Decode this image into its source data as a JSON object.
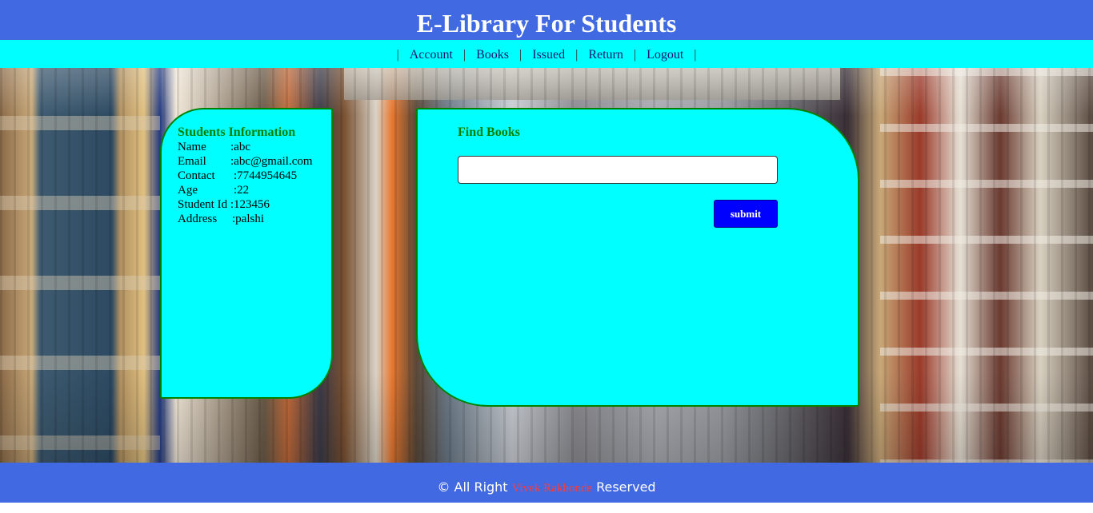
{
  "header": {
    "title": "E-Library For Students"
  },
  "nav": {
    "separator": "|",
    "items": [
      "Account",
      "Books",
      "Issued",
      "Return",
      "Logout"
    ]
  },
  "student_info": {
    "title": "Students Information",
    "fields": [
      {
        "label": "Name",
        "value": ":abc"
      },
      {
        "label": "Email",
        "value": ":abc@gmail.com"
      },
      {
        "label": "Contact",
        "value": ":7744954645"
      },
      {
        "label": "Age",
        "value": ":22"
      },
      {
        "label": "Student Id",
        "value": ":123456"
      },
      {
        "label": "Address",
        "value": ":palshi"
      }
    ]
  },
  "find_books": {
    "title": "Find Books",
    "search_value": "",
    "submit_label": "submit"
  },
  "footer": {
    "prefix": "© All Right",
    "author": "Vivek Rakhonde",
    "suffix": "Reserved"
  },
  "colors": {
    "header_bg": "#4169e1",
    "nav_bg": "#00ffff",
    "card_bg": "#00ffff",
    "card_border": "#008000",
    "button_bg": "#0000ff",
    "author_text": "#ff3b3b"
  }
}
